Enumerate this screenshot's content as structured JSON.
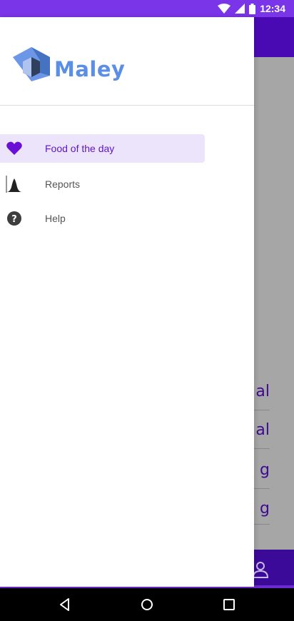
{
  "status_bar": {
    "time": "12:34",
    "icons": [
      "wifi-icon",
      "cell-signal-icon",
      "battery-icon"
    ]
  },
  "drawer": {
    "brand": {
      "name": "Maley",
      "color": "#5b8fe6"
    },
    "items": [
      {
        "label": "Food of the day",
        "icon": "heart-icon",
        "active": true
      },
      {
        "label": "Reports",
        "icon": "bell-curve-icon",
        "active": false
      },
      {
        "label": "Help",
        "icon": "help-icon",
        "active": false
      }
    ]
  },
  "background": {
    "rows": [
      "al",
      "al",
      "g",
      "g"
    ]
  },
  "colors": {
    "primary": "#7a35e8",
    "accent": "#5d14c8",
    "active_bg": "#ebe4fb"
  }
}
